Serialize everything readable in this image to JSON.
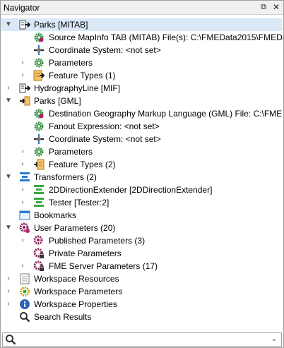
{
  "window": {
    "title": "Navigator",
    "float_glyph": "⧉",
    "close_glyph": "✕"
  },
  "search": {
    "value": "",
    "placeholder": "",
    "icon": "search-icon",
    "dropdown_glyph": "⌄"
  },
  "colors": {
    "selection": "#dbe8f8",
    "gear": "#2e8b3a",
    "bar_blue": "#2c7bd0",
    "bar_green": "#3aa845"
  },
  "tree": {
    "parks_mitab": {
      "label": "Parks [MITAB]",
      "icon": "reader-dataset-icon",
      "source": "Source MapInfo TAB (MITAB) File(s): C:\\FMEData2015\\FMEDa",
      "coordinate_system": "Coordinate System: <not set>",
      "parameters": "Parameters",
      "feature_types": "Feature Types (1)"
    },
    "hydrography": {
      "label": "HydrographyLine [MIF]",
      "icon": "reader-dataset-icon"
    },
    "parks_gml": {
      "label": "Parks [GML]",
      "icon": "writer-dataset-icon",
      "destination": "Destination Geography Markup Language (GML) File: C:\\FME",
      "fanout": "Fanout Expression: <not set>",
      "coordinate_system": "Coordinate System: <not set>",
      "parameters": "Parameters",
      "feature_types": "Feature Types (2)"
    },
    "transformers": {
      "label": "Transformers (2)",
      "items": [
        "2DDirectionExtender [2DDirectionExtender]",
        "Tester [Tester:2]"
      ]
    },
    "bookmarks": {
      "label": "Bookmarks"
    },
    "user_parameters": {
      "label": "User Parameters (20)",
      "published": "Published Parameters (3)",
      "private": "Private Parameters",
      "fme_server": "FME Server Parameters (17)"
    },
    "workspace_resources": {
      "label": "Workspace Resources"
    },
    "workspace_parameters": {
      "label": "Workspace Parameters"
    },
    "workspace_properties": {
      "label": "Workspace Properties"
    },
    "search_results": {
      "label": "Search Results"
    }
  }
}
